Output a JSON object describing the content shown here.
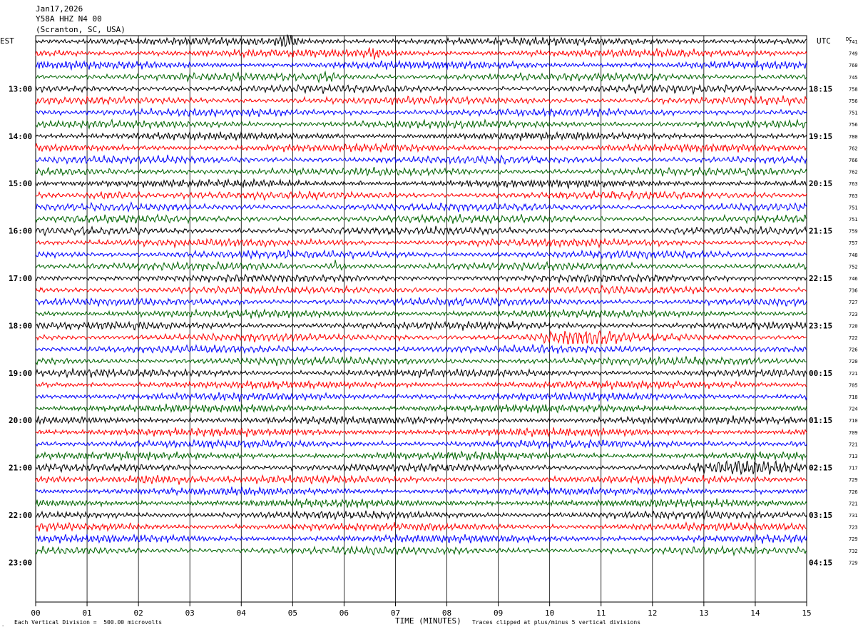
{
  "header": {
    "date": "Jan17,2026",
    "station": "Y58A HHZ N4 00",
    "location": "(Scranton, SC, USA)"
  },
  "left_timezone": "EST",
  "right_timezone": "UTC",
  "dc_label": "DC",
  "footer": {
    "scale_note": "Each Vertical Division =  500.00 microvolts",
    "xlabel": "TIME (MINUTES)",
    "clip_note": "Traces clipped at plus/minus 5 vertical divisions"
  },
  "chart_data": {
    "type": "line",
    "title": "",
    "xlabel": "TIME (MINUTES)",
    "ylabel": "",
    "xlim": [
      0,
      15
    ],
    "x_ticks": [
      "00",
      "01",
      "02",
      "03",
      "04",
      "05",
      "06",
      "07",
      "08",
      "09",
      "10",
      "11",
      "12",
      "13",
      "14",
      "15"
    ],
    "grid": true,
    "trace_colors": [
      "#000000",
      "#ff0000",
      "#0000ff",
      "#006400"
    ],
    "row_count": 44,
    "left_hour_labels": [
      "13:00",
      "14:00",
      "15:00",
      "16:00",
      "17:00",
      "18:00",
      "19:00",
      "20:00",
      "21:00",
      "22:00",
      "23:00"
    ],
    "right_hour_labels": [
      "18:15",
      "19:15",
      "20:15",
      "21:15",
      "22:15",
      "23:15",
      "00:15",
      "01:15",
      "02:15",
      "03:15",
      "04:15"
    ],
    "hour_label_first_row": 4,
    "hour_label_every": 4,
    "dc_values": [
      741,
      749,
      760,
      745,
      758,
      756,
      751,
      756,
      780,
      762,
      766,
      762,
      763,
      763,
      751,
      751,
      759,
      757,
      748,
      752,
      746,
      736,
      727,
      723,
      720,
      722,
      726,
      720,
      721,
      705,
      718,
      724,
      710,
      709,
      721,
      713,
      717,
      729,
      726,
      721,
      731,
      723,
      729,
      732,
      729
    ],
    "bursts": [
      {
        "row": 0,
        "start_min": 4.6,
        "end_min": 5.2,
        "amplitude": 2.2
      },
      {
        "row": 1,
        "start_min": 6.3,
        "end_min": 6.9,
        "amplitude": 1.4
      },
      {
        "row": 3,
        "start_min": 5.4,
        "end_min": 5.9,
        "amplitude": 1.6
      },
      {
        "row": 13,
        "start_min": 0.8,
        "end_min": 2.1,
        "amplitude": 1.5
      },
      {
        "row": 19,
        "start_min": 5.6,
        "end_min": 6.1,
        "amplitude": 1.6
      },
      {
        "row": 25,
        "start_min": 9.4,
        "end_min": 11.8,
        "amplitude": 1.6
      },
      {
        "row": 37,
        "start_min": 0.9,
        "end_min": 3.4,
        "amplitude": 1.3
      },
      {
        "row": 36,
        "start_min": 12.6,
        "end_min": 15.0,
        "amplitude": 1.3
      }
    ]
  }
}
